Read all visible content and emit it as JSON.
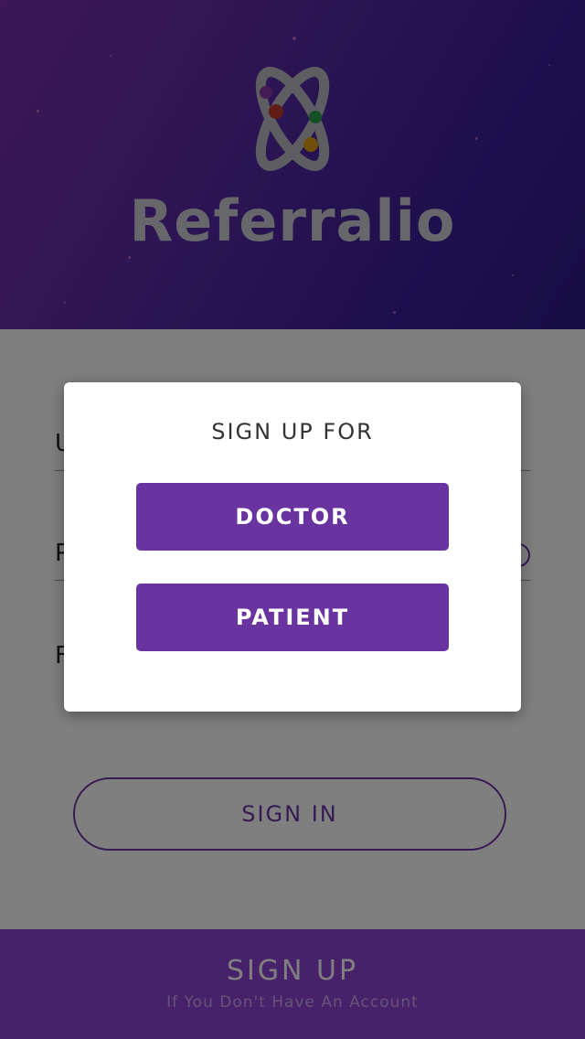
{
  "app": {
    "brand_name": "Referralio"
  },
  "form": {
    "username_label": "U",
    "password_label": "P",
    "forgot_label": "F",
    "signin_label": "SIGN IN"
  },
  "footer": {
    "signup_label": "SIGN UP",
    "signup_subtitle": "If You Don't Have An Account"
  },
  "modal": {
    "title": "SIGN UP FOR",
    "options": [
      {
        "label": "DOCTOR"
      },
      {
        "label": "PATIENT"
      }
    ]
  },
  "colors": {
    "primary": "#6933a0",
    "header_start": "#7a2fb0",
    "header_end": "#2d1a8c",
    "overlay": "rgba(0,0,0,0.5)"
  },
  "icons": {
    "logo": "atom-logo-icon",
    "password_toggle": "eye-toggle-icon"
  }
}
